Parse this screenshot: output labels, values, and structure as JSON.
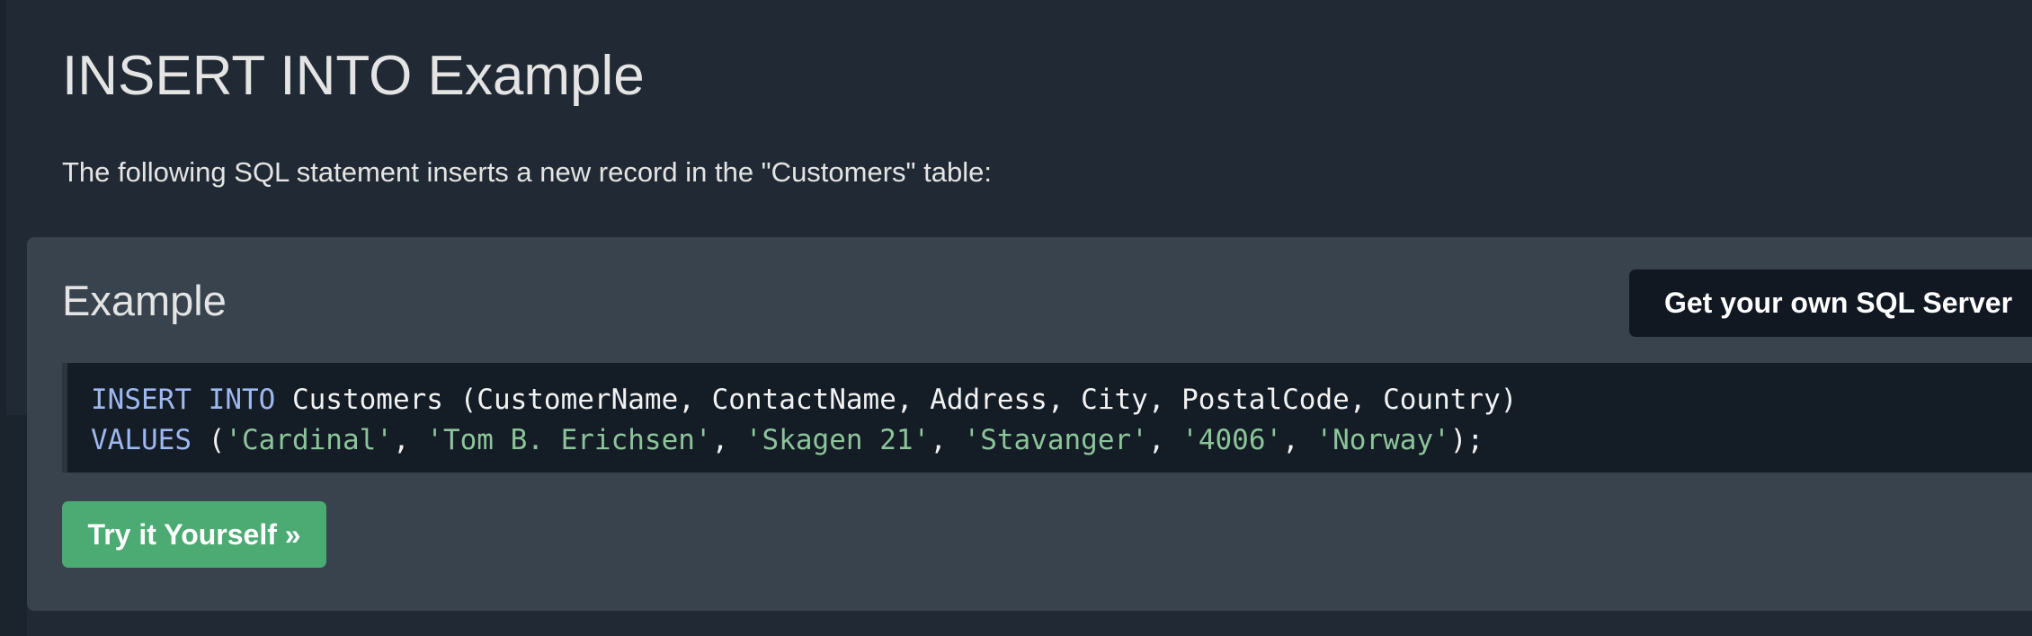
{
  "page": {
    "title": "INSERT INTO Example",
    "intro": "The following SQL statement inserts a new record in the \"Customers\" table:"
  },
  "example": {
    "heading": "Example",
    "server_button": "Get your own SQL Server",
    "try_button": "Try it Yourself »",
    "code": {
      "line1": {
        "kw1": "INSERT",
        "kw2": "INTO",
        "rest": " Customers (CustomerName, ContactName, Address, City, PostalCode, Country)"
      },
      "line2": {
        "kw": "VALUES",
        "open": " (",
        "v1": "'Cardinal'",
        "v2": "'Tom B. Erichsen'",
        "v3": "'Skagen 21'",
        "v4": "'Stavanger'",
        "v5": "'4006'",
        "v6": "'Norway'",
        "sep": ", ",
        "close": ");"
      }
    }
  },
  "colors": {
    "background": "#212a34",
    "panel": "#38434e",
    "code_background": "#141c25",
    "keyword": "#9eb8f0",
    "string": "#8cc59a",
    "try_button": "#4caa73",
    "server_button": "#111821"
  }
}
